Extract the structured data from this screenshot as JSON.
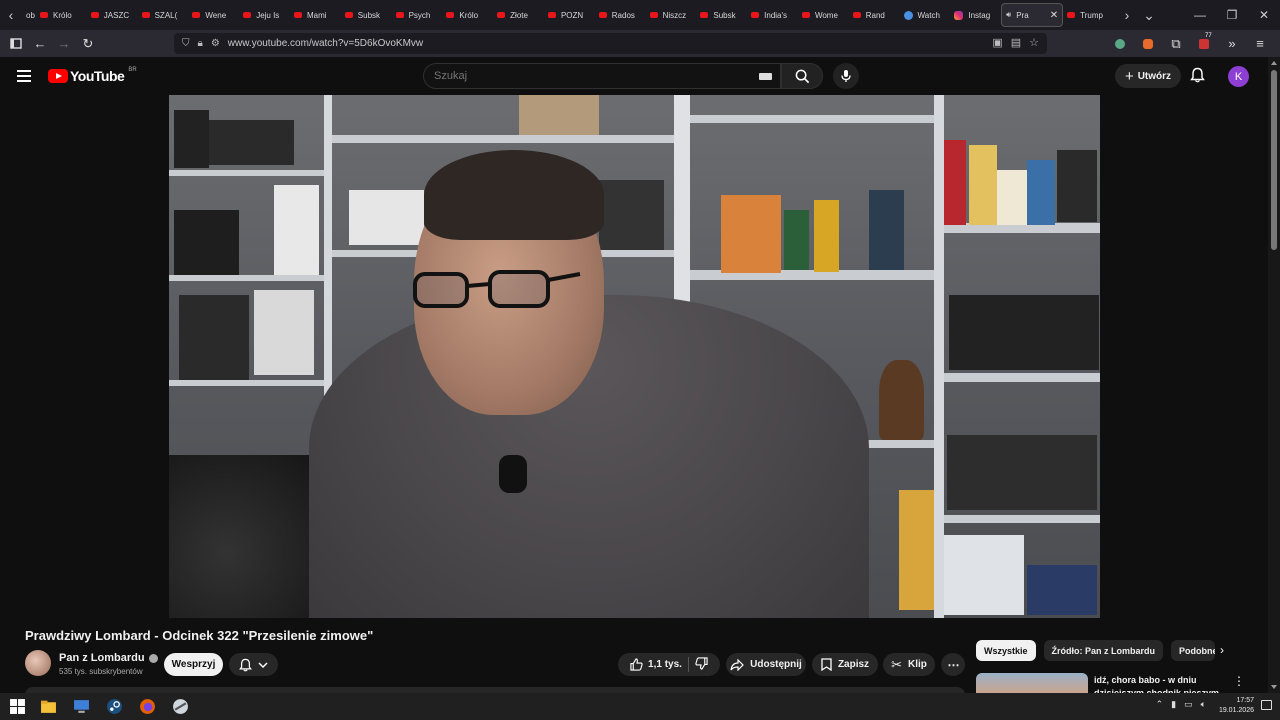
{
  "browser": {
    "tabs": [
      {
        "label": "Królo",
        "icon": "youtube"
      },
      {
        "label": "JASZC",
        "icon": "youtube"
      },
      {
        "label": "SZAL(",
        "icon": "youtube"
      },
      {
        "label": "Wene",
        "icon": "youtube"
      },
      {
        "label": "Jeju Is",
        "icon": "youtube"
      },
      {
        "label": "Mami",
        "icon": "youtube"
      },
      {
        "label": "Subsk",
        "icon": "youtube"
      },
      {
        "label": "Psych",
        "icon": "youtube"
      },
      {
        "label": "Królo",
        "icon": "youtube"
      },
      {
        "label": "Złote",
        "icon": "youtube"
      },
      {
        "label": "POZN",
        "icon": "youtube"
      },
      {
        "label": "Rados",
        "icon": "youtube"
      },
      {
        "label": "Niszcz",
        "icon": "youtube"
      },
      {
        "label": "Subsk",
        "icon": "youtube"
      },
      {
        "label": "India's",
        "icon": "youtube"
      },
      {
        "label": "Wome",
        "icon": "youtube"
      },
      {
        "label": "Rand",
        "icon": "youtube"
      },
      {
        "label": "Watch",
        "icon": "globe"
      },
      {
        "label": "Instag",
        "icon": "instagram"
      },
      {
        "label": "Pra",
        "icon": "speaker",
        "active": true
      },
      {
        "label": "Trump",
        "icon": "youtube"
      }
    ],
    "first_tab_label": "ob",
    "url": "www.youtube.com/watch?v=5D6kOvoKMvw",
    "extension_badge": "77"
  },
  "youtube": {
    "logo_text": "YouTube",
    "country_code": "BR",
    "search_placeholder": "Szukaj",
    "create_label": "Utwórz",
    "avatar_letter": "K"
  },
  "video": {
    "title": "Prawdziwy Lombard - Odcinek 322 \"Przesilenie zimowe\"",
    "channel_name": "Pan z Lombardu",
    "subscribers": "535 tys. subskrybentów",
    "support_label": "Wesprzyj",
    "likes": "1,1 tys.",
    "share_label": "Udostępnij",
    "save_label": "Zapisz",
    "clip_label": "Klip"
  },
  "sidebar": {
    "chips": [
      "Wszystkie",
      "Źródło: Pan z Lombardu",
      "Podobne"
    ],
    "recommended_title": "idź, chora babo - w dniu dzisiejszym chodnik pieszym"
  },
  "taskbar": {
    "time": "17:57",
    "date": "19.01.2026"
  },
  "colors": {
    "youtube_red": "#ff0000",
    "background": "#0f0f0f",
    "avatar": "#8e3fd3"
  }
}
